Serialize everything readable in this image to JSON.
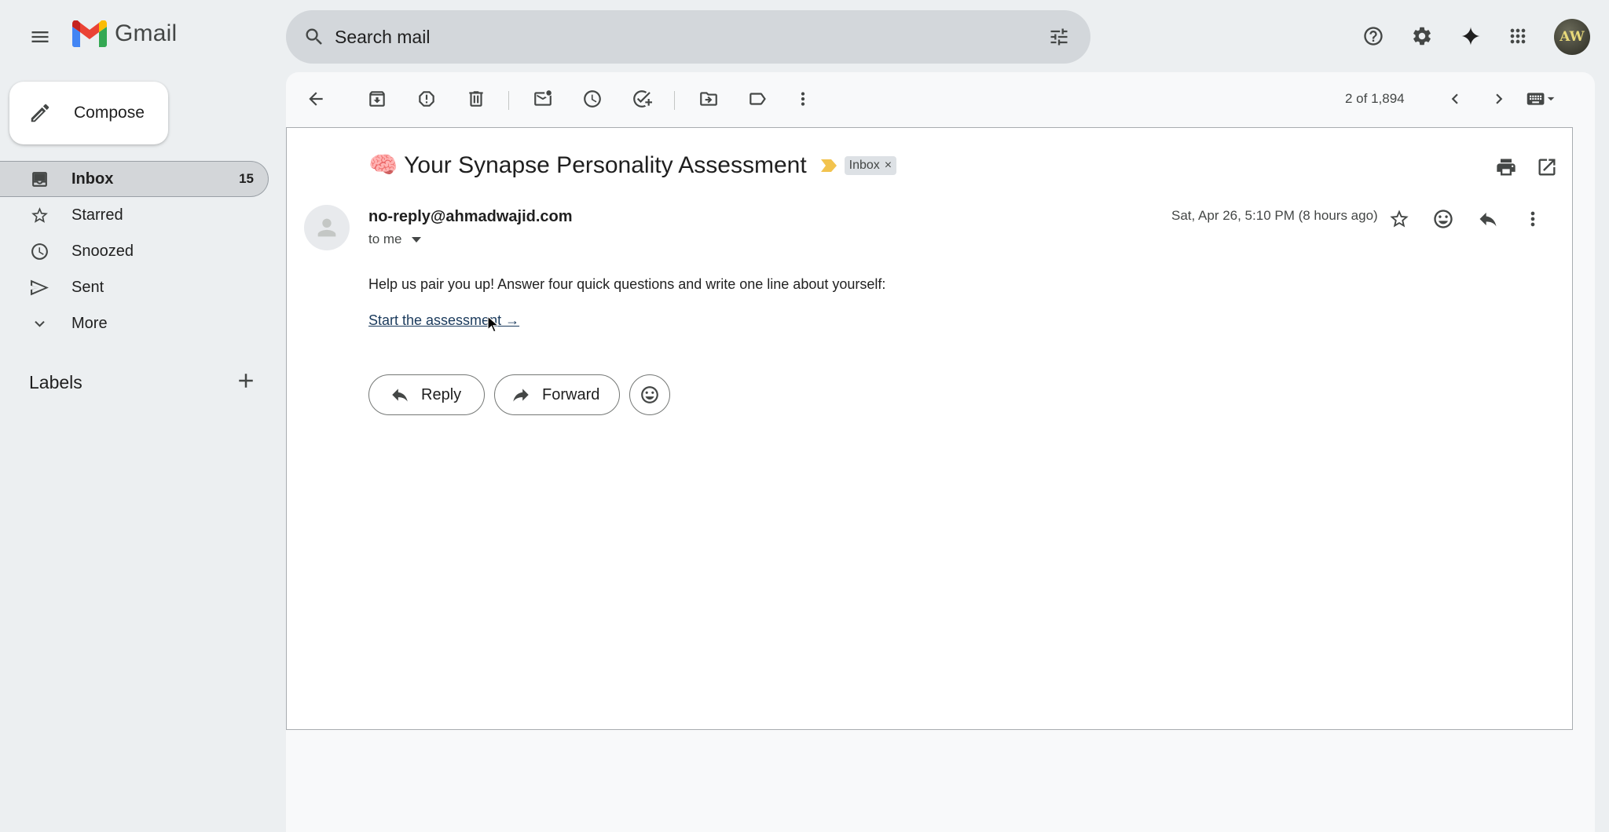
{
  "header": {
    "app_name": "Gmail",
    "search_placeholder": "Search mail",
    "avatar_initials": "AW"
  },
  "sidebar": {
    "compose_label": "Compose",
    "items": [
      {
        "label": "Inbox",
        "count": "15",
        "icon": "inbox-icon",
        "active": true
      },
      {
        "label": "Starred",
        "icon": "star-icon"
      },
      {
        "label": "Snoozed",
        "icon": "clock-icon"
      },
      {
        "label": "Sent",
        "icon": "send-icon"
      },
      {
        "label": "More",
        "icon": "chevron-down-icon"
      }
    ],
    "labels_title": "Labels"
  },
  "toolbar": {
    "pager": "2 of 1,894"
  },
  "email": {
    "subject": "🧠 Your Synapse Personality Assessment",
    "label_chip": "Inbox",
    "chip_close": "×",
    "sender": "no-reply@ahmadwajid.com",
    "recipient": "to me",
    "date": "Sat, Apr 26, 5:10 PM (8 hours ago)",
    "body": "Help us pair you up! Answer four quick questions and write one line about yourself:",
    "link_text": "Start the assessment →",
    "reply_label": "Reply",
    "forward_label": "Forward"
  },
  "colors": {
    "importance_marker": "#f2c34e",
    "background": "#eceff1",
    "active_nav": "#d3d6d9"
  }
}
